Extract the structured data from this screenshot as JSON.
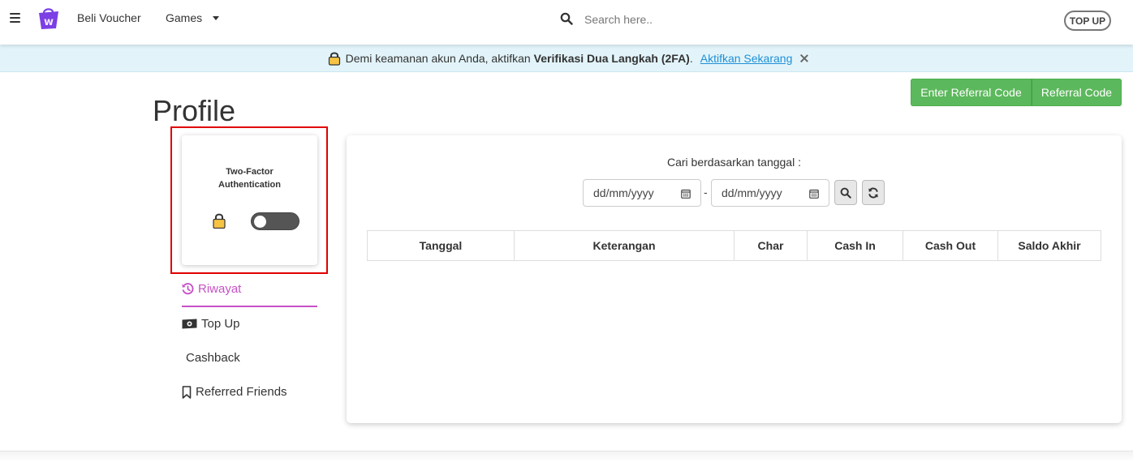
{
  "header": {
    "nav_voucher": "Beli Voucher",
    "nav_games": "Games",
    "search_placeholder": "Search here..",
    "topup_label": "TOP UP",
    "brand_color": "#7b3fe4"
  },
  "banner": {
    "text_before": "Demi keamanan akun Anda, aktifkan",
    "text_bold": "Verifikasi Dua Langkah (2FA)",
    "text_after": ".",
    "link_label": "Aktifkan Sekarang"
  },
  "referral": {
    "enter_label": "Enter Referral Code",
    "code_label": "Referral Code",
    "color": "#5cb85c"
  },
  "profile": {
    "title": "Profile",
    "two_factor": {
      "title_line1": "Two-Factor",
      "title_line2": "Authentication",
      "enabled": false
    }
  },
  "menu": {
    "riwayat": "Riwayat",
    "top_up": "Top Up",
    "cashback": "Cashback",
    "referred_friends": "Referred Friends",
    "active_color": "#c651c6"
  },
  "filter": {
    "label": "Cari berdasarkan tanggal :",
    "start_placeholder": "dd/mm/yyyy",
    "end_placeholder": "dd/mm/yyyy",
    "separator": "-"
  },
  "table": {
    "columns": [
      "Tanggal",
      "Keterangan",
      "Char",
      "Cash In",
      "Cash Out",
      "Saldo Akhir"
    ]
  }
}
